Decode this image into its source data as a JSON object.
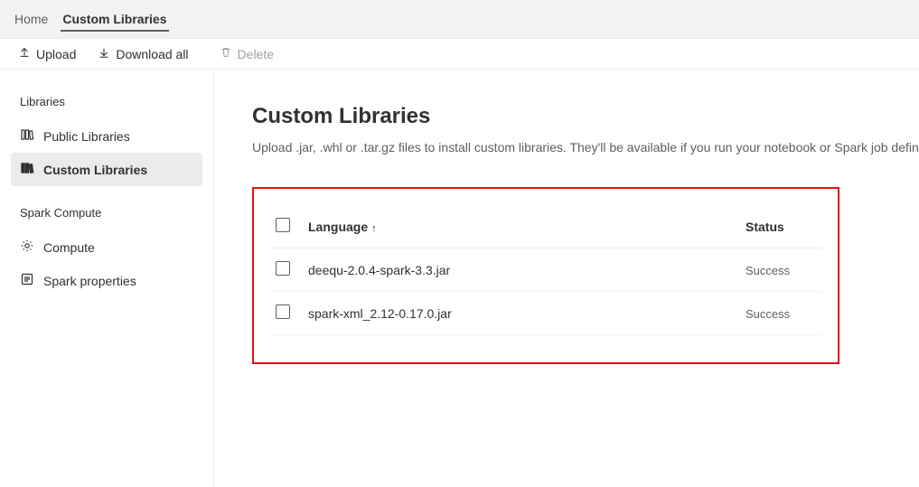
{
  "tabs": {
    "home": "Home",
    "custom_libraries": "Custom Libraries"
  },
  "toolbar": {
    "upload": "Upload",
    "download_all": "Download all",
    "delete": "Delete"
  },
  "sidebar": {
    "sections": {
      "libraries_title": "Libraries",
      "spark_compute_title": "Spark Compute"
    },
    "items": {
      "public_libraries": "Public Libraries",
      "custom_libraries": "Custom Libraries",
      "compute": "Compute",
      "spark_properties": "Spark properties"
    }
  },
  "page": {
    "title": "Custom Libraries",
    "desc": "Upload .jar, .whl or .tar.gz files to install custom libraries. They'll be available if you run your notebook or Spark job definition in this environmen"
  },
  "table": {
    "headers": {
      "language": "Language",
      "status": "Status"
    },
    "rows": [
      {
        "name": "deequ-2.0.4-spark-3.3.jar",
        "status": "Success"
      },
      {
        "name": "spark-xml_2.12-0.17.0.jar",
        "status": "Success"
      }
    ]
  }
}
